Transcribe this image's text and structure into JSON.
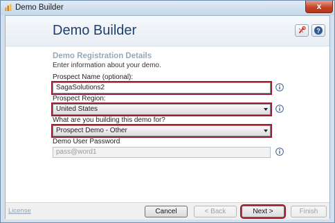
{
  "window": {
    "title": "Demo Builder",
    "close_glyph": "x"
  },
  "header": {
    "title": "Demo Builder",
    "brand_color": "#1f3f6f"
  },
  "section": {
    "title": "Demo Registration Details",
    "description": "Enter information about your demo."
  },
  "fields": {
    "prospect_name": {
      "label": "Prospect Name (optional):",
      "value": "SagaSolutions2"
    },
    "prospect_region": {
      "label": "Prospect Region:",
      "value": "United States"
    },
    "demo_purpose": {
      "label": "What are you building this demo for?",
      "value": "Prospect Demo - Other"
    },
    "demo_password": {
      "label": "Demo User Password",
      "value": "pass@word1"
    }
  },
  "footer": {
    "license_link": "License",
    "cancel": "Cancel",
    "back": "< Back",
    "next": "Next >",
    "finish": "Finish"
  },
  "colors": {
    "highlight": "#a31c2b",
    "info_icon": "#3d5f8c"
  }
}
